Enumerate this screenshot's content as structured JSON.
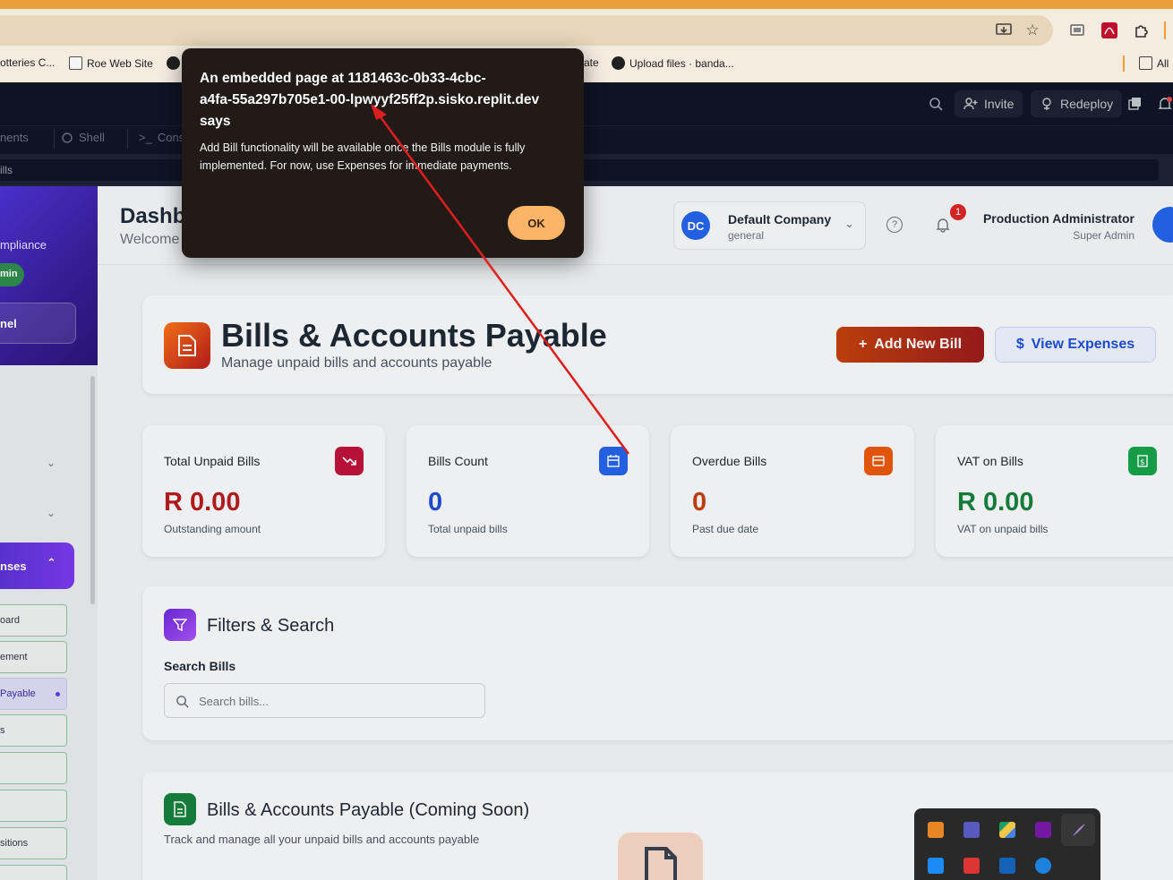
{
  "browser": {
    "bookmarks": [
      {
        "label": "otteries C..."
      },
      {
        "label": "Roe Web Site"
      },
      {
        "label": "ate"
      },
      {
        "label": "Upload files · banda..."
      },
      {
        "label": "All"
      }
    ]
  },
  "replit": {
    "invite_label": "Invite",
    "redeploy_label": "Redeploy",
    "tabs": [
      {
        "label": "nents"
      },
      {
        "label": "Shell"
      },
      {
        "label": "Cons"
      }
    ],
    "url_fragment": "ills"
  },
  "sidebar": {
    "compliance_label": "mpliance",
    "admin_badge": "min",
    "panel_label": "nel",
    "expenses_label": "nses",
    "items": [
      {
        "label": "oard"
      },
      {
        "label": "ement"
      },
      {
        "label": "Payable"
      },
      {
        "label": "s"
      },
      {
        "label": ""
      },
      {
        "label": ""
      },
      {
        "label": "sitions"
      },
      {
        "label": ""
      }
    ]
  },
  "header": {
    "title": "Dashb",
    "welcome": "Welcome",
    "company_initials": "DC",
    "company_name": "Default Company",
    "company_sub": "general",
    "notification_count": "1",
    "user_name": "Production Administrator",
    "user_role": "Super Admin"
  },
  "page": {
    "title": "Bills & Accounts Payable",
    "subtitle": "Manage unpaid bills and accounts payable",
    "add_bill_label": "Add New Bill",
    "view_expenses_label": "View Expenses"
  },
  "kpis": [
    {
      "title": "Total Unpaid Bills",
      "value": "R 0.00",
      "sub": "Outstanding amount",
      "color": "#b91c1c",
      "icon_bg": "#be123c",
      "icon": "trending-down-icon"
    },
    {
      "title": "Bills Count",
      "value": "0",
      "sub": "Total unpaid bills",
      "color": "#1d4ed8",
      "icon_bg": "#2563eb",
      "icon": "calendar-icon"
    },
    {
      "title": "Overdue Bills",
      "value": "0",
      "sub": "Past due date",
      "color": "#c2410c",
      "icon_bg": "#ea580c",
      "icon": "card-icon"
    },
    {
      "title": "VAT on Bills",
      "value": "R 0.00",
      "sub": "VAT on unpaid bills",
      "color": "#15803d",
      "icon_bg": "#16a34a",
      "icon": "receipt-icon"
    }
  ],
  "filters": {
    "title": "Filters & Search",
    "search_label": "Search Bills",
    "search_placeholder": "Search bills..."
  },
  "coming_soon": {
    "title": "Bills & Accounts Payable (Coming Soon)",
    "subtitle": "Track and manage all your unpaid bills and accounts payable"
  },
  "dialog": {
    "heading_line1": "An embedded page at 1181463c-0b33-4cbc-",
    "heading_line2": "a4fa-55a297b705e1-00-lpwyyf25ff2p.sisko.replit.dev",
    "heading_line3": "says",
    "message_line1": "Add Bill functionality will be available once the Bills module is fully",
    "message_line2": "implemented. For now, use Expenses for immediate payments.",
    "ok_label": "OK"
  }
}
